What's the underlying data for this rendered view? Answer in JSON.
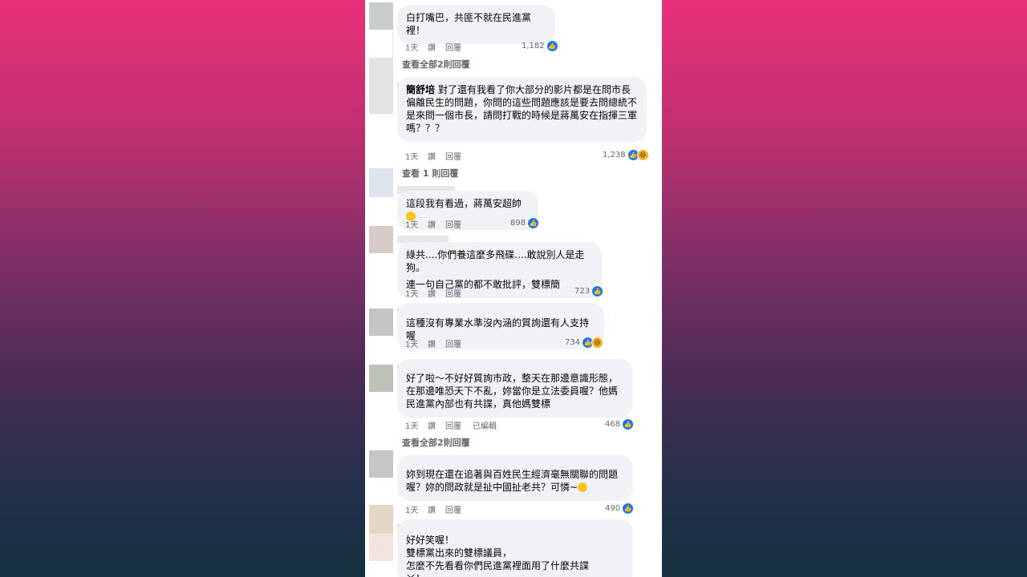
{
  "comments": [
    {
      "name": "",
      "text": "白打嘴巴，共匪不就在民進黨裡！",
      "time": "1天",
      "action2": "讚",
      "reply": "回覆",
      "count": "1,182",
      "more": "查看全部2則回覆"
    },
    {
      "name": "簡舒培",
      "text": "對了還有我看了你大部分的影片都是在問市長偏離民生的問題，你問的這些問題應該是要去問總統不是來問一個市長，請問打戰的時候是蔣萬安在指揮三軍嗎？？？",
      "time": "1天",
      "action2": "讚",
      "reply": "回覆",
      "count": "1,238",
      "more": "查看 1 則回覆"
    },
    {
      "name": "",
      "text": "這段我有看過，蔣萬安超帥",
      "time": "1天",
      "action2": "讚",
      "reply": "回覆",
      "count": "898"
    },
    {
      "name": "",
      "text": "綠共....你們養這麼多飛碟....敢說別人是走狗。",
      "text2": "連一句自己黨的都不敢批評，雙標簡",
      "time": "1天",
      "action2": "讚",
      "reply": "回覆",
      "count": "723"
    },
    {
      "name": "",
      "text": "這種沒有專業水準沒內涵的質詢還有人支持喔",
      "time": "1天",
      "action2": "讚",
      "reply": "回覆",
      "count": "734"
    },
    {
      "name": "",
      "text": "好了啦～不好好質詢市政，整天在那邊意識形態，在那邊唯恐天下不亂，妳當你是立法委員喔？他媽民進黨內部也有共諜，真他媽雙標",
      "time": "1天",
      "action2": "讚",
      "reply": "回覆",
      "edited": "已編輯",
      "count": "468",
      "more": "查看全部2則回覆"
    },
    {
      "name": "",
      "text": "妳到現在還在追著與百姓民生經濟毫無關聯的問題喔？妳的問政就是扯中國扯老共？可憐~",
      "time": "1天",
      "action2": "讚",
      "reply": "回覆",
      "count": "490"
    },
    {
      "name": "",
      "line1": "好好笑喔！",
      "line2": "雙標黨出來的雙標議員，",
      "line3": "怎麼不先看看你們民進黨裡面用了什麼共諜ㄚ！......"
    }
  ],
  "colors": {
    "like": "#1877f2",
    "haha": "#f7b125",
    "bubble": "#f0f2f5",
    "meta": "#65676b"
  }
}
